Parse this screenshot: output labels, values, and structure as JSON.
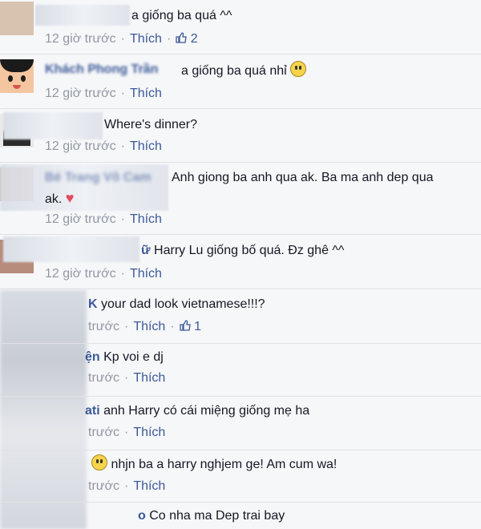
{
  "comments": [
    {
      "text": "a giống ba quá ^^",
      "time": "12 giờ trước",
      "action": "Thích",
      "likes": "2"
    },
    {
      "name": "Khách Phong Trần",
      "text": "a giống ba quá nhỉ",
      "time": "12 giờ trước",
      "action": "Thích"
    },
    {
      "text": "Where's dinner?",
      "time": "12 giờ trước",
      "action": "Thích"
    },
    {
      "name": "Bé Trang Võ Cam",
      "text": "Anh giong ba anh qua ak. Ba ma anh dep qua",
      "text2": "ak.",
      "time": "12 giờ trước",
      "action": "Thích"
    },
    {
      "name": "ữ",
      "text": "Harry Lu giống bố quá. Đz ghê ^^",
      "time": "12 giờ trước",
      "action": "Thích"
    },
    {
      "name": "K",
      "text": "your dad look vietnamese!!!?",
      "time": "trước",
      "action": "Thích",
      "likes": "1"
    },
    {
      "name": "ện",
      "text": "Kp voi e dj",
      "time": "trước",
      "action": "Thích"
    },
    {
      "name": "ati",
      "text": "anh Harry có cái miệng giống mẹ ha",
      "time": "trước",
      "action": "Thích"
    },
    {
      "text": "nhjn ba a harry nghjem ge! Am cum wa!",
      "time": "trước",
      "action": "Thích"
    },
    {
      "name": "o",
      "text": "Co nha ma Dep trai bay"
    }
  ]
}
